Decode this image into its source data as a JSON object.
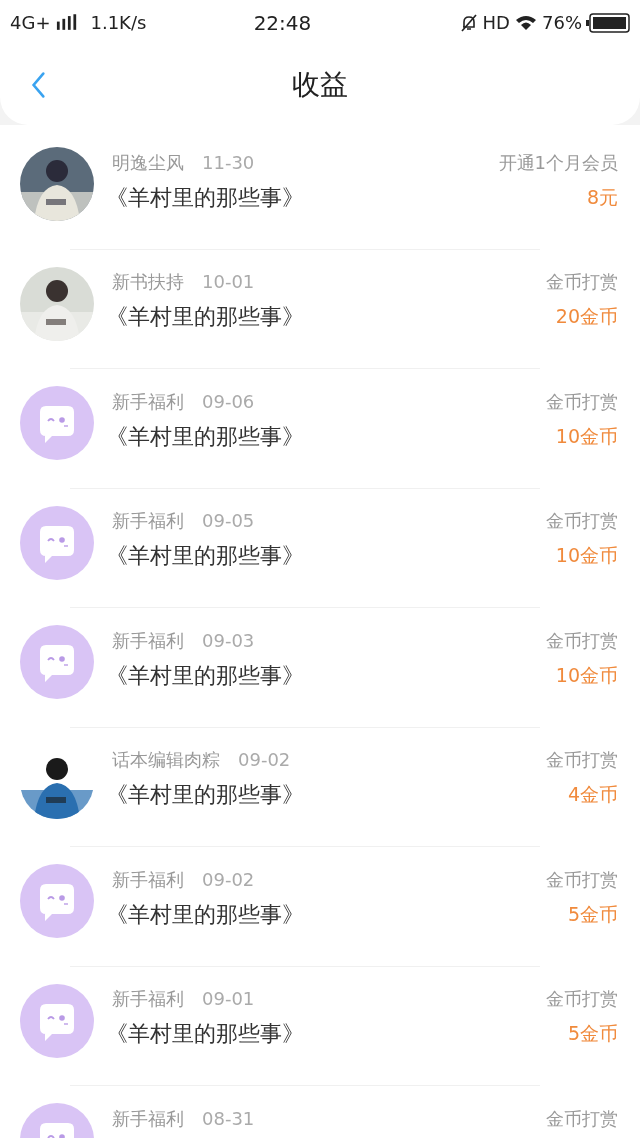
{
  "status_bar": {
    "network": "4G+",
    "speed": "1.1K/s",
    "time": "22:48",
    "hd": "HD",
    "battery": "76%"
  },
  "header": {
    "title": "收益"
  },
  "rows": [
    {
      "kind": "picture",
      "source": "明逸尘风",
      "date": "11-30",
      "book": "《羊村里的那些事》",
      "type": "开通1个月会员",
      "amount": "8元"
    },
    {
      "kind": "picture",
      "source": "新书扶持",
      "date": "10-01",
      "book": "《羊村里的那些事》",
      "type": "金币打赏",
      "amount": "20金币"
    },
    {
      "kind": "bot",
      "source": "新手福利",
      "date": "09-06",
      "book": "《羊村里的那些事》",
      "type": "金币打赏",
      "amount": "10金币"
    },
    {
      "kind": "bot",
      "source": "新手福利",
      "date": "09-05",
      "book": "《羊村里的那些事》",
      "type": "金币打赏",
      "amount": "10金币"
    },
    {
      "kind": "bot",
      "source": "新手福利",
      "date": "09-03",
      "book": "《羊村里的那些事》",
      "type": "金币打赏",
      "amount": "10金币"
    },
    {
      "kind": "picture",
      "source": "话本编辑肉粽",
      "date": "09-02",
      "book": "《羊村里的那些事》",
      "type": "金币打赏",
      "amount": "4金币"
    },
    {
      "kind": "bot",
      "source": "新手福利",
      "date": "09-02",
      "book": "《羊村里的那些事》",
      "type": "金币打赏",
      "amount": "5金币"
    },
    {
      "kind": "bot",
      "source": "新手福利",
      "date": "09-01",
      "book": "《羊村里的那些事》",
      "type": "金币打赏",
      "amount": "5金币"
    },
    {
      "kind": "bot",
      "source": "新手福利",
      "date": "08-31",
      "type": "金币打赏"
    }
  ]
}
